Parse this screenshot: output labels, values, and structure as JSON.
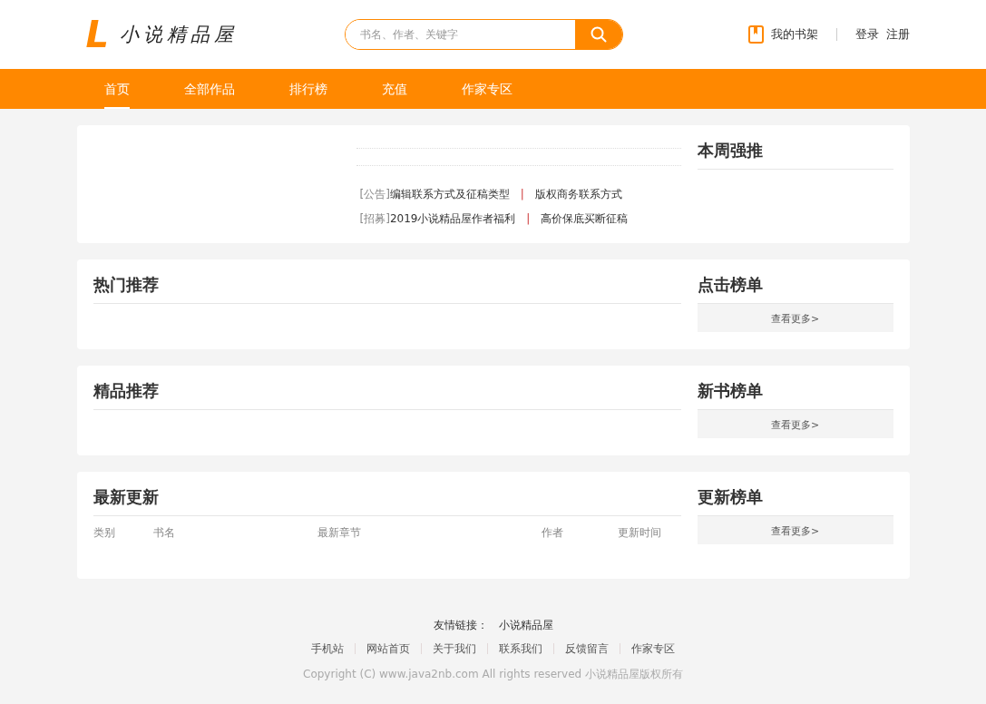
{
  "header": {
    "logo_mark": "L",
    "logo_text": "小说精品屋",
    "search": {
      "placeholder": "书名、作者、关键字"
    },
    "bookshelf": "我的书架",
    "login": "登录",
    "register": "注册"
  },
  "nav": [
    {
      "label": "首页",
      "selected": true
    },
    {
      "label": "全部作品",
      "selected": false
    },
    {
      "label": "排行榜",
      "selected": false
    },
    {
      "label": "充值",
      "selected": false
    },
    {
      "label": "作家专区",
      "selected": false
    }
  ],
  "top_section": {
    "notices": [
      {
        "tag": "[公告]",
        "first": "编辑联系方式及征稿类型",
        "second": "版权商务联系方式"
      },
      {
        "tag": "[招募]",
        "first": "2019小说精品屋作者福利",
        "second": "高价保底买断征稿"
      }
    ],
    "separator": "|",
    "side_title": "本周强推"
  },
  "sections": [
    {
      "kind": "plain",
      "title": "热门推荐",
      "side_title": "点击榜单",
      "more": "查看更多>"
    },
    {
      "kind": "plain",
      "title": "精品推荐",
      "side_title": "新书榜单",
      "more": "查看更多>"
    },
    {
      "kind": "table",
      "title": "最新更新",
      "side_title": "更新榜单",
      "more": "查看更多>",
      "columns": [
        "类别",
        "书名",
        "最新章节",
        "作者",
        "更新时间"
      ]
    }
  ],
  "footer": {
    "friend_label": "友情链接：",
    "friend_links": [
      "小说精品屋"
    ],
    "links": [
      "手机站",
      "网站首页",
      "关于我们",
      "联系我们",
      "反馈留言",
      "作家专区"
    ],
    "copyright": "Copyright (C) www.java2nb.com All rights reserved  小说精品屋版权所有"
  }
}
